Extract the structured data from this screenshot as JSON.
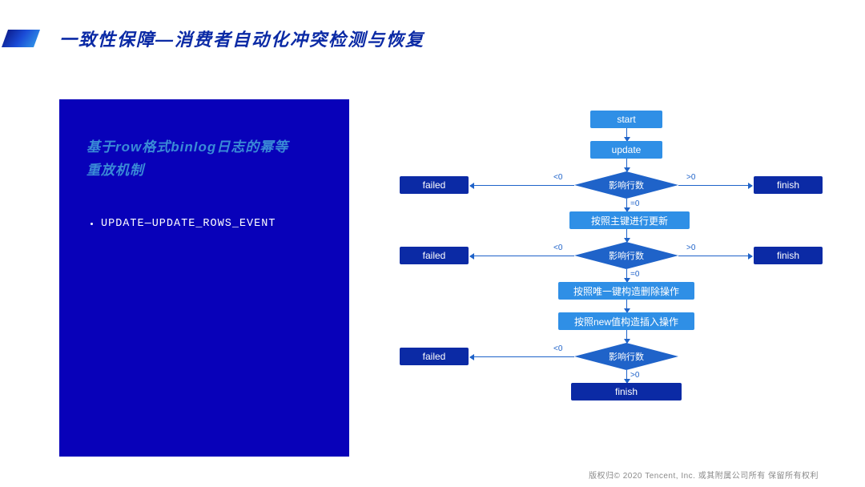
{
  "title": "一致性保障—消费者自动化冲突检测与恢复",
  "panel": {
    "heading_l1": "基于row格式binlog日志的幂等",
    "heading_l2": "重放机制",
    "bullet1": "UPDATE—UPDATE_ROWS_EVENT"
  },
  "flow": {
    "start": "start",
    "update": "update",
    "failed": "failed",
    "finish": "finish",
    "decision": "影响行数",
    "step_pk_update": "按照主键进行更新",
    "step_uk_delete": "按照唯一键构造删除操作",
    "step_new_insert": "按照new值构造插入操作",
    "lt0": "<0",
    "eq0": "=0",
    "gt0": ">0"
  },
  "footer": "版权归©  2020 Tencent, Inc. 或其附属公司所有  保留所有权利"
}
